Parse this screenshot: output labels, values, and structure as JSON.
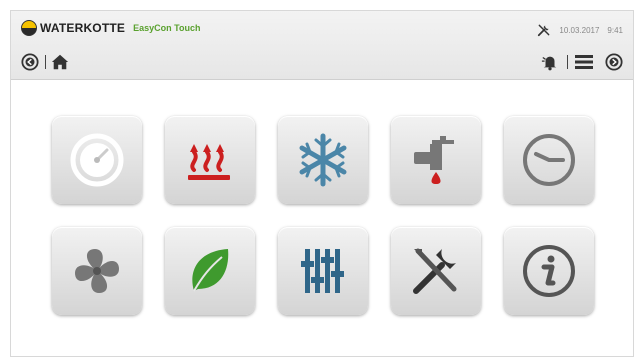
{
  "header": {
    "brand": "WATERKOTTE",
    "product": "EasyCon Touch",
    "date": "10.03.2017",
    "time": "9:41",
    "status_icon": "wrench-screwdriver-icon"
  },
  "nav": {
    "left": [
      "back-icon",
      "home-icon"
    ],
    "right": [
      "alarm-bell-icon",
      "menu-icon",
      "forward-icon"
    ]
  },
  "tiles": [
    {
      "name": "dashboard-gauge-icon"
    },
    {
      "name": "heating-icon"
    },
    {
      "name": "cooling-snowflake-icon"
    },
    {
      "name": "hot-water-tap-icon"
    },
    {
      "name": "clock-icon"
    },
    {
      "name": "fan-icon"
    },
    {
      "name": "eco-leaf-icon"
    },
    {
      "name": "settings-sliders-icon"
    },
    {
      "name": "service-tools-icon"
    },
    {
      "name": "info-icon"
    }
  ],
  "colors": {
    "brand_green": "#5aa12f",
    "heating_red": "#cc1f1f",
    "cooling_blue": "#4b86a8",
    "icon_gray": "#777777"
  }
}
